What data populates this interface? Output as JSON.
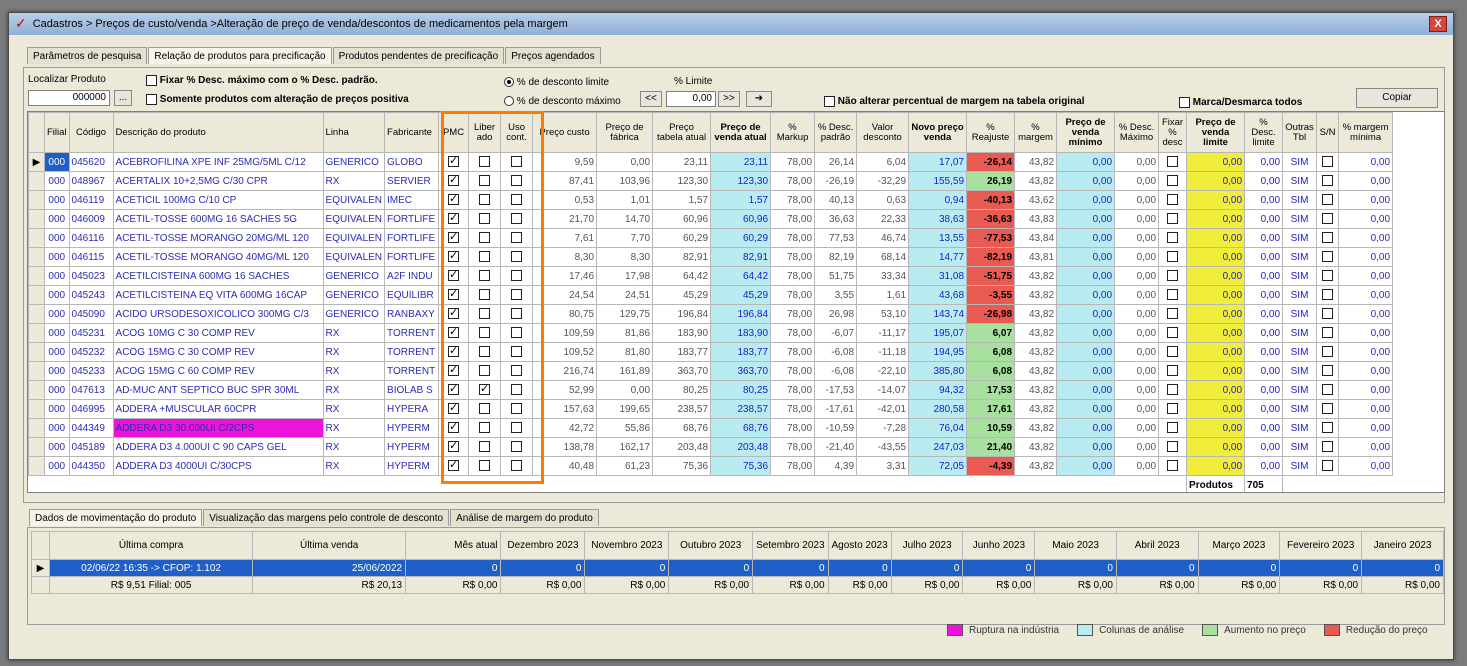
{
  "window": {
    "title": "Cadastros > Preços de custo/venda >Alteração de preço de venda/descontos de medicamentos pela margem",
    "close": "X"
  },
  "tabs": [
    "Parâmetros de pesquisa",
    "Relação de produtos para precificação",
    "Produtos pendentes de precificação",
    "Preços agendados"
  ],
  "filters": {
    "localizar_label": "Localizar Produto",
    "localizar_value": "000000",
    "browse": "...",
    "fixar_desc": "Fixar % Desc. máximo com o % Desc. padrão.",
    "somente_alteracao": "Somente produtos com alteração de preços positiva",
    "radio_limite": "% de desconto limite",
    "radio_maximo": "% de desconto máximo",
    "limite_label": "% Limite",
    "limite_value": "0,00",
    "nav_prev": "<<",
    "nav_next": ">>",
    "nav_apply": "➜",
    "nao_alterar": "Não alterar percentual de margem na tabela original",
    "marca_desmarca": "Marca/Desmarca todos",
    "copiar": "Copiar"
  },
  "columns": [
    "Filial",
    "Código",
    "Descrição do produto",
    "Linha",
    "Fabricante",
    "PMC",
    "Liber ado",
    "Uso cont.",
    "Preço custo",
    "Preço de fábrica",
    "Preço tabela atual",
    "Preço de venda atual",
    "% Markup",
    "% Desc. padrão",
    "Valor desconto",
    "Novo preço venda",
    "% Reajuste",
    "% margem",
    "Preço de venda mínimo",
    "% Desc. Máximo",
    "Fixar % desc",
    "Preço de venda limite",
    "% Desc. limite",
    "Outras Tbl",
    "S/N",
    "% margem mínima"
  ],
  "rows": [
    [
      "000",
      "045620",
      "ACEBROFILINA XPE INF 25MG/5ML C/12",
      "GENERICO",
      "GLOBO",
      true,
      false,
      false,
      "9,59",
      "0,00",
      "23,11",
      "23,11",
      "78,00",
      "26,14",
      "6,04",
      "17,07",
      "-26,14",
      "43,82",
      "0,00",
      "0,00",
      false,
      "0,00",
      "0,00",
      "SIM",
      false,
      "0,00"
    ],
    [
      "000",
      "048967",
      "ACERTALIX 10+2,5MG C/30 CPR",
      "RX",
      "SERVIER",
      true,
      false,
      false,
      "87,41",
      "103,96",
      "123,30",
      "123,30",
      "78,00",
      "-26,19",
      "-32,29",
      "155,59",
      "26,19",
      "43,82",
      "0,00",
      "0,00",
      false,
      "0,00",
      "0,00",
      "SIM",
      false,
      "0,00"
    ],
    [
      "000",
      "046119",
      "ACETICIL 100MG C/10 CP",
      "EQUIVALEN",
      "IMEC",
      true,
      false,
      false,
      "0,53",
      "1,01",
      "1,57",
      "1,57",
      "78,00",
      "40,13",
      "0,63",
      "0,94",
      "-40,13",
      "43,62",
      "0,00",
      "0,00",
      false,
      "0,00",
      "0,00",
      "SIM",
      false,
      "0,00"
    ],
    [
      "000",
      "046009",
      "ACETIL-TOSSE 600MG 16 SACHES 5G",
      "EQUIVALEN",
      "FORTLIFE",
      true,
      false,
      false,
      "21,70",
      "14,70",
      "60,96",
      "60,96",
      "78,00",
      "36,63",
      "22,33",
      "38,63",
      "-36,63",
      "43,83",
      "0,00",
      "0,00",
      false,
      "0,00",
      "0,00",
      "SIM",
      false,
      "0,00"
    ],
    [
      "000",
      "046116",
      "ACETIL-TOSSE MORANGO 20MG/ML 120",
      "EQUIVALEN",
      "FORTLIFE",
      true,
      false,
      false,
      "7,61",
      "7,70",
      "60,29",
      "60,29",
      "78,00",
      "77,53",
      "46,74",
      "13,55",
      "-77,53",
      "43,84",
      "0,00",
      "0,00",
      false,
      "0,00",
      "0,00",
      "SIM",
      false,
      "0,00"
    ],
    [
      "000",
      "046115",
      "ACETIL-TOSSE MORANGO 40MG/ML 120",
      "EQUIVALEN",
      "FORTLIFE",
      true,
      false,
      false,
      "8,30",
      "8,30",
      "82,91",
      "82,91",
      "78,00",
      "82,19",
      "68,14",
      "14,77",
      "-82,19",
      "43,81",
      "0,00",
      "0,00",
      false,
      "0,00",
      "0,00",
      "SIM",
      false,
      "0,00"
    ],
    [
      "000",
      "045023",
      "ACETILCISTEINA 600MG 16 SACHES",
      "GENERICO",
      "A2F INDU",
      true,
      false,
      false,
      "17,46",
      "17,98",
      "64,42",
      "64,42",
      "78,00",
      "51,75",
      "33,34",
      "31,08",
      "-51,75",
      "43,82",
      "0,00",
      "0,00",
      false,
      "0,00",
      "0,00",
      "SIM",
      false,
      "0,00"
    ],
    [
      "000",
      "045243",
      "ACETILCISTEINA EQ VITA 600MG 16CAP",
      "GENERICO",
      "EQUILIBR",
      true,
      false,
      false,
      "24,54",
      "24,51",
      "45,29",
      "45,29",
      "78,00",
      "3,55",
      "1,61",
      "43,68",
      "-3,55",
      "43,82",
      "0,00",
      "0,00",
      false,
      "0,00",
      "0,00",
      "SIM",
      false,
      "0,00"
    ],
    [
      "000",
      "045090",
      "ACIDO URSODESOXICOLICO 300MG C/3",
      "GENERICO",
      "RANBAXY",
      true,
      false,
      false,
      "80,75",
      "129,75",
      "196,84",
      "196,84",
      "78,00",
      "26,98",
      "53,10",
      "143,74",
      "-26,98",
      "43,82",
      "0,00",
      "0,00",
      false,
      "0,00",
      "0,00",
      "SIM",
      false,
      "0,00"
    ],
    [
      "000",
      "045231",
      "ACOG 10MG C 30 COMP REV",
      "RX",
      "TORRENT",
      true,
      false,
      false,
      "109,59",
      "81,86",
      "183,90",
      "183,90",
      "78,00",
      "-6,07",
      "-11,17",
      "195,07",
      "6,07",
      "43,82",
      "0,00",
      "0,00",
      false,
      "0,00",
      "0,00",
      "SIM",
      false,
      "0,00"
    ],
    [
      "000",
      "045232",
      "ACOG 15MG C 30 COMP REV",
      "RX",
      "TORRENT",
      true,
      false,
      false,
      "109,52",
      "81,80",
      "183,77",
      "183,77",
      "78,00",
      "-6,08",
      "-11,18",
      "194,95",
      "6,08",
      "43,82",
      "0,00",
      "0,00",
      false,
      "0,00",
      "0,00",
      "SIM",
      false,
      "0,00"
    ],
    [
      "000",
      "045233",
      "ACOG 15MG C 60 COMP REV",
      "RX",
      "TORRENT",
      true,
      false,
      false,
      "216,74",
      "161,89",
      "363,70",
      "363,70",
      "78,00",
      "-6,08",
      "-22,10",
      "385,80",
      "6,08",
      "43,82",
      "0,00",
      "0,00",
      false,
      "0,00",
      "0,00",
      "SIM",
      false,
      "0,00"
    ],
    [
      "000",
      "047613",
      "AD-MUC ANT SEPTICO BUC SPR 30ML",
      "RX",
      "BIOLAB S",
      true,
      true,
      false,
      "52,99",
      "0,00",
      "80,25",
      "80,25",
      "78,00",
      "-17,53",
      "-14,07",
      "94,32",
      "17,53",
      "43,82",
      "0,00",
      "0,00",
      false,
      "0,00",
      "0,00",
      "SIM",
      false,
      "0,00"
    ],
    [
      "000",
      "046995",
      "ADDERA +MUSCULAR 60CPR",
      "RX",
      "HYPERA",
      true,
      false,
      false,
      "157,63",
      "199,65",
      "238,57",
      "238,57",
      "78,00",
      "-17,61",
      "-42,01",
      "280,58",
      "17,61",
      "43,82",
      "0,00",
      "0,00",
      false,
      "0,00",
      "0,00",
      "SIM",
      false,
      "0,00"
    ],
    [
      "000",
      "044349",
      "ADDERA D3 30.000UI C/2CPS",
      "RX",
      "HYPERM",
      true,
      false,
      false,
      "42,72",
      "55,86",
      "68,76",
      "68,76",
      "78,00",
      "-10,59",
      "-7,28",
      "76,04",
      "10,59",
      "43,82",
      "0,00",
      "0,00",
      false,
      "0,00",
      "0,00",
      "SIM",
      false,
      "0,00"
    ],
    [
      "000",
      "045189",
      "ADDERA D3 4.000UI C 90 CAPS GEL",
      "RX",
      "HYPERM",
      true,
      false,
      false,
      "138,78",
      "162,17",
      "203,48",
      "203,48",
      "78,00",
      "-21,40",
      "-43,55",
      "247,03",
      "21,40",
      "43,82",
      "0,00",
      "0,00",
      false,
      "0,00",
      "0,00",
      "SIM",
      false,
      "0,00"
    ],
    [
      "000",
      "044350",
      "ADDERA D3 4000UI C/30CPS",
      "RX",
      "HYPERM",
      true,
      false,
      false,
      "40,48",
      "61,23",
      "75,36",
      "75,36",
      "78,00",
      "4,39",
      "3,31",
      "72,05",
      "-4,39",
      "43,82",
      "0,00",
      "0,00",
      false,
      "0,00",
      "0,00",
      "SIM",
      false,
      "0,00"
    ]
  ],
  "footer": {
    "produtos_label": "Produtos",
    "produtos_count": "705"
  },
  "bottom_tabs": [
    "Dados de movimentação do produto",
    "Visualização das margens pelo controle de desconto",
    "Análise de margem do produto"
  ],
  "mov_columns": [
    "Última compra",
    "Última venda",
    "Mês atual",
    "Dezembro 2023",
    "Novembro 2023",
    "Outubro 2023",
    "Setembro 2023",
    "Agosto 2023",
    "Julho 2023",
    "Junho 2023",
    "Maio 2023",
    "Abril 2023",
    "Março 2023",
    "Fevereiro 2023",
    "Janeiro 2023"
  ],
  "mov_rows": [
    [
      "02/06/22 16:35 -> CFOP: 1.102",
      "25/06/2022",
      "0",
      "0",
      "0",
      "0",
      "0",
      "0",
      "0",
      "0",
      "0",
      "0",
      "0",
      "0",
      "0"
    ],
    [
      "R$ 9,51 Filial: 005",
      "R$ 20,13",
      "R$ 0,00",
      "R$ 0,00",
      "R$ 0,00",
      "R$ 0,00",
      "R$ 0,00",
      "R$ 0,00",
      "R$ 0,00",
      "R$ 0,00",
      "R$ 0,00",
      "R$ 0,00",
      "R$ 0,00",
      "R$ 0,00",
      "R$ 0,00"
    ]
  ],
  "legend": [
    {
      "label": "Ruptura na indústria",
      "color": "#ec14d8"
    },
    {
      "label": "Colunas de análise",
      "color": "#b9ecf0"
    },
    {
      "label": "Aumento no preço",
      "color": "#a8e0a0"
    },
    {
      "label": "Redução do preço",
      "color": "#e85a52"
    }
  ]
}
